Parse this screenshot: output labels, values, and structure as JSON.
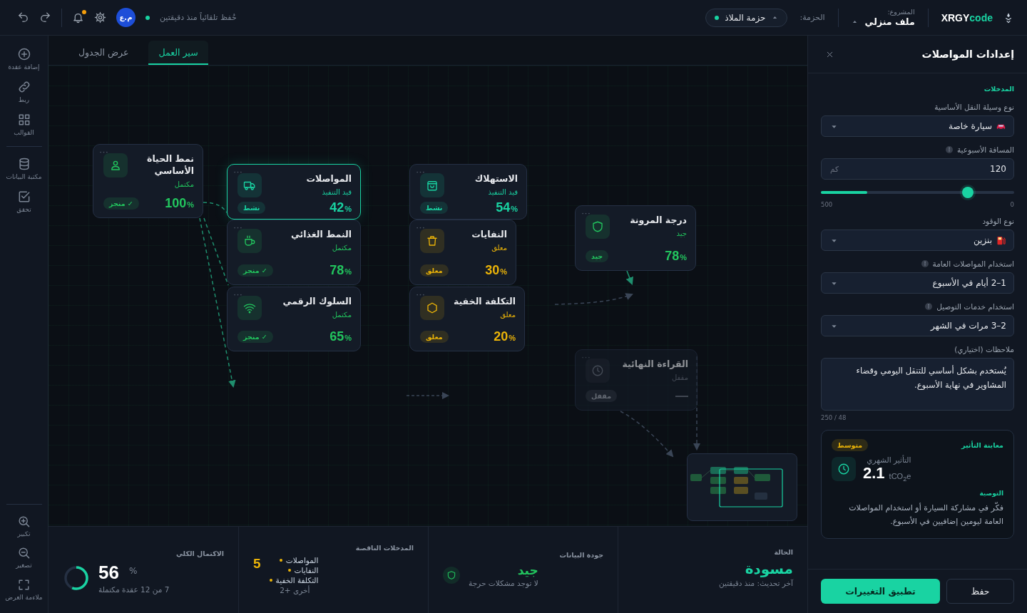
{
  "topbar": {
    "logo_prefix": "XRGY",
    "logo_suffix": "code",
    "project_label": "المشروع:",
    "project_name": "ملف منزلي",
    "package_label": "الحزمة:",
    "package_name": "حزمة الملاذ",
    "autosave": "حُفظ تلقائياً منذ دقيقتين",
    "avatar": "م.ع",
    "notifications": true
  },
  "tools": [
    {
      "label": "إضافة عقدة"
    },
    {
      "label": "ربط"
    },
    {
      "label": "القوالب"
    },
    {
      "label": "مكتبة البيانات"
    },
    {
      "label": "تحقق"
    }
  ],
  "view_tools": [
    {
      "label": "تكبير"
    },
    {
      "label": "تصغير"
    },
    {
      "label": "ملاءمة العرض"
    }
  ],
  "tabs": [
    {
      "label": "سير العمل",
      "selected": true
    },
    {
      "label": "عرض الجدول",
      "selected": false
    }
  ],
  "nodes": [
    {
      "title": "نمط الحياة الأساسي",
      "status": "مكتمل",
      "value": "100",
      "unit": "%",
      "badge": "✓ منجز",
      "kind": "done",
      "selected": false
    },
    {
      "title": "المواصلات",
      "status": "قيد التنفيذ",
      "value": "42",
      "unit": "%",
      "badge": "نشط",
      "kind": "active",
      "selected": true
    },
    {
      "title": "النمط الغذائي",
      "status": "مكتمل",
      "value": "78",
      "unit": "%",
      "badge": "✓ منجز",
      "kind": "done",
      "selected": false
    },
    {
      "title": "السلوك الرقمي",
      "status": "مكتمل",
      "value": "65",
      "unit": "%",
      "badge": "✓ منجز",
      "kind": "done",
      "selected": false
    },
    {
      "title": "الاستهلاك",
      "status": "قيد التنفيذ",
      "value": "54",
      "unit": "%",
      "badge": "نشط",
      "kind": "active",
      "selected": false
    },
    {
      "title": "النفايات",
      "status": "معلق",
      "value": "30",
      "unit": "%",
      "badge": "معلق",
      "kind": "pending",
      "selected": false
    },
    {
      "title": "التكلفة الخفية",
      "status": "معلق",
      "value": "20",
      "unit": "%",
      "badge": "معلق",
      "kind": "pending",
      "selected": false
    },
    {
      "title": "درجة المرونة",
      "status": "جيد",
      "value": "78",
      "unit": "%",
      "badge": "جيد",
      "kind": "done",
      "selected": false
    },
    {
      "title": "القراءة النهائية",
      "status": "مقفل",
      "value": "—",
      "badge": "مقفل",
      "kind": "locked",
      "selected": false
    }
  ],
  "stats": [
    {
      "kind": "status",
      "label": "الحالة",
      "value": "مسودة",
      "note": "آخر تحديث: منذ دقيقتين"
    },
    {
      "kind": "quality",
      "label": "جودة البيانات",
      "value": "جيد",
      "note": "لا توجد مشكلات حرجة"
    },
    {
      "kind": "missing",
      "label": "المدخلات الناقصة",
      "value": "5",
      "items": [
        "المواصلات",
        "النفايات",
        "التكلفة الخفية"
      ],
      "note": "أخرى +2"
    },
    {
      "kind": "completion",
      "label": "الاكتمال الكلي",
      "value": "56",
      "unit": "%",
      "level": 0.56,
      "note": "7 من 12 عقدة مكتملة"
    }
  ],
  "settings": {
    "title": "إعدادات المواصلات",
    "section": "المدخلات",
    "fields": [
      {
        "kind": "select",
        "label": "نوع وسيلة النقل الأساسية",
        "info": false,
        "value": "سيارة خاصة"
      },
      {
        "kind": "number",
        "label": "المسافة الأسبوعية",
        "info": true,
        "value": "120",
        "unit": "كم",
        "level": 0.24,
        "min": "0",
        "max": "500"
      },
      {
        "kind": "select",
        "label": "نوع الوقود",
        "info": false,
        "value": "بنزين"
      },
      {
        "kind": "select",
        "label": "استخدام المواصلات العامة",
        "info": true,
        "value": "1–2 أيام في الأسبوع"
      },
      {
        "kind": "select",
        "label": "استخدام خدمات التوصيل",
        "info": true,
        "value": "2–3 مرات في الشهر"
      },
      {
        "kind": "textarea",
        "label": "ملاحظات (اختياري)",
        "info": false,
        "value": "يُستخدم بشكل أساسي للتنقل اليومي وقضاء المشاوير في نهاية الأسبوع.",
        "counter": "48 / 250"
      }
    ],
    "impact": {
      "title": "معاينة التأثير",
      "badge": "متوسط",
      "label": "التأثير الشهري",
      "value": "2.1",
      "unit": "tCO$_{2}$e",
      "rec_title": "التوصية",
      "recommendation": "فكّر في مشاركة السيارة أو استخدام المواصلات العامة ليومين إضافيين في الأسبوع."
    },
    "buttons": [
      {
        "label": "حفظ",
        "kind": "secondary"
      },
      {
        "label": "تطبيق التغييرات",
        "kind": "primary"
      }
    ]
  }
}
